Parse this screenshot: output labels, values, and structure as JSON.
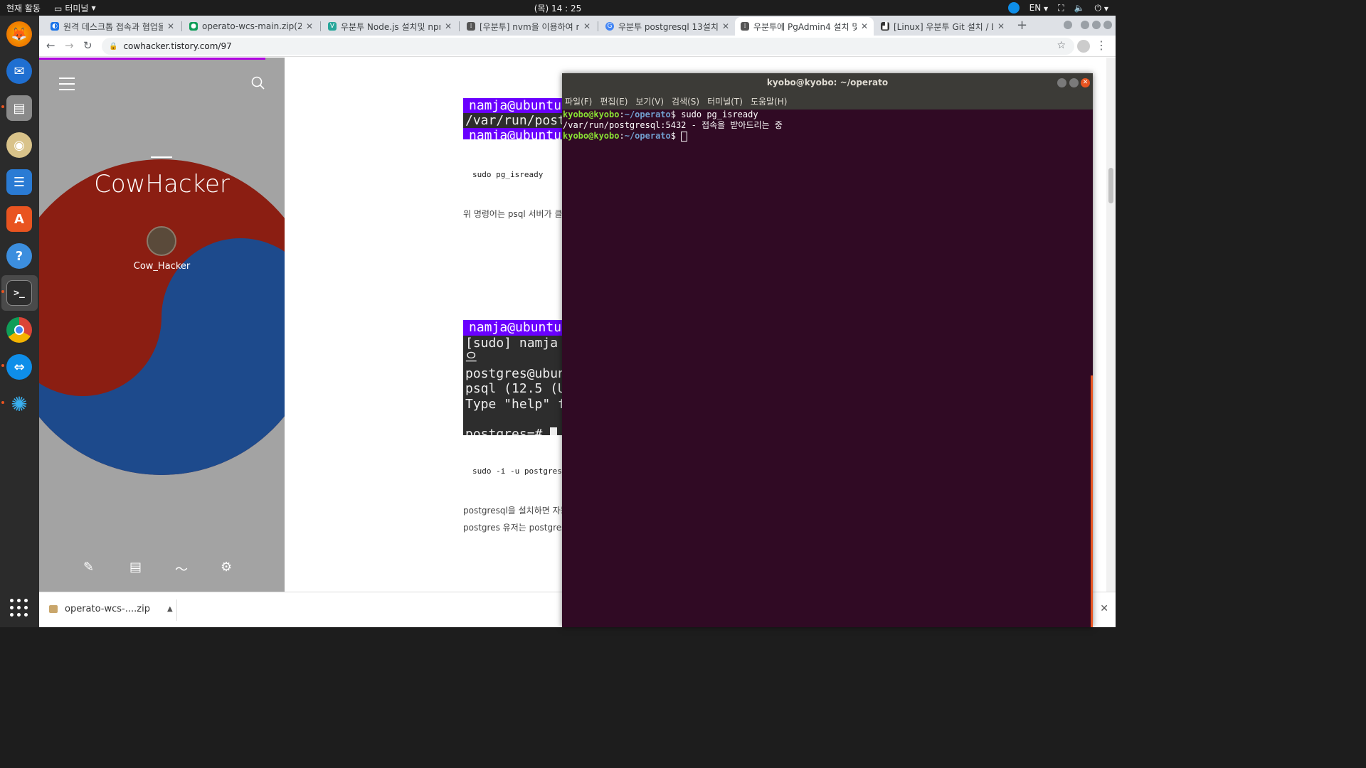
{
  "topbar": {
    "activities": "현재 활동",
    "app_name": "터미널",
    "clock": "(목) 14 : 25",
    "language": "EN"
  },
  "dock": {
    "apps": [
      "firefox",
      "thunderbird",
      "files",
      "rhythmbox",
      "libreoffice-writer",
      "ubuntu-software",
      "help",
      "terminal",
      "chrome",
      "teamviewer",
      "other-app"
    ]
  },
  "browser": {
    "tabs": [
      {
        "label": "원격 데스크톱 접속과 협업을",
        "active": false
      },
      {
        "label": "operato-wcs-main.zip(2)",
        "active": false
      },
      {
        "label": "우분투 Node.js 설치및 npm",
        "active": false
      },
      {
        "label": "[우분투] nvm을 이용하여 n",
        "active": false
      },
      {
        "label": "우분투 postgresql 13설치",
        "active": false
      },
      {
        "label": "우분투에 PgAdmin4 설치 및",
        "active": true
      },
      {
        "label": "[Linux] 우분투 Git 설치 / D",
        "active": false
      }
    ],
    "url": "cowhacker.tistory.com/97",
    "download": {
      "filename": "operato-wcs-....zip"
    }
  },
  "blog": {
    "title": "CowHacker",
    "author": "Cow_Hacker",
    "code1_lines": [
      "namja@ubuntu",
      "/var/run/post",
      "namja@ubuntu"
    ],
    "cmd1": "sudo pg_isready",
    "para1": "위 명령어는 psql 서버가 클",
    "code2_lines": [
      "namja@ubuntu",
      "[sudo] namja으",
      "postgres@ubun",
      "psql (12.5 (U",
      "Type \"help\" f",
      "",
      "postgres=# "
    ],
    "cmd2": "sudo -i -u postgres",
    "para2": "postgresql을 설치하면 자동",
    "para3": "postgres 유저는 postgres"
  },
  "terminal": {
    "title": "kyobo@kyobo: ~/operato",
    "menu": [
      "파일(F)",
      "편집(E)",
      "보기(V)",
      "검색(S)",
      "터미널(T)",
      "도움말(H)"
    ],
    "prompt_user": "kyobo@kyobo",
    "prompt_path": "~/operato",
    "command": "sudo pg_isready",
    "output": "/var/run/postgresql:5432 - 접속을 받아드리는 중"
  },
  "colors": {
    "terminal_bg": "#300a24",
    "accent": "#e95420",
    "prompt_user": "#8ae234",
    "prompt_path": "#729fcf"
  }
}
